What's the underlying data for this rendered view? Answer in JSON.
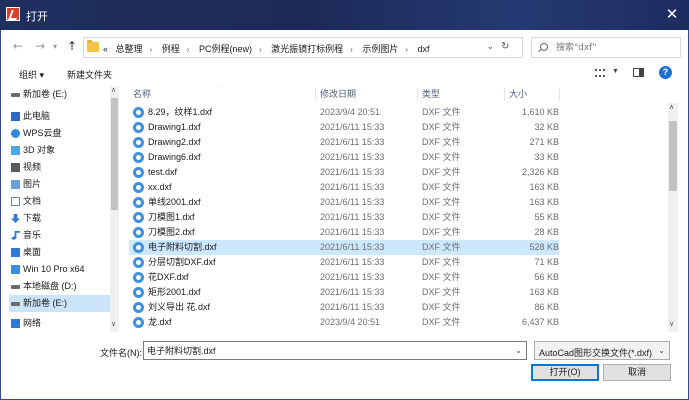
{
  "window": {
    "title": "打开",
    "close_label": "✕"
  },
  "address": {
    "crumbs": [
      "总整理",
      "例程",
      "PC例程(new)",
      "激光振镜打标例程",
      "示例图片",
      "dxf"
    ],
    "lead": "«"
  },
  "search": {
    "placeholder": "搜索\"dxf\""
  },
  "toolbar": {
    "organize_label": "组织 ▾",
    "newfolder_label": "新建文件夹",
    "help_label": "?"
  },
  "nav": {
    "items": [
      {
        "label": "新加卷 (E:)",
        "icon": "drive-icon"
      },
      {
        "label": "此电脑",
        "icon": "pc-icon"
      },
      {
        "label": "WPS云盘",
        "icon": "cloud-icon"
      },
      {
        "label": "3D 对象",
        "icon": "3d-icon"
      },
      {
        "label": "视频",
        "icon": "video-icon"
      },
      {
        "label": "图片",
        "icon": "picture-icon"
      },
      {
        "label": "文档",
        "icon": "document-icon"
      },
      {
        "label": "下载",
        "icon": "download-icon"
      },
      {
        "label": "音乐",
        "icon": "music-icon"
      },
      {
        "label": "桌面",
        "icon": "desktop-icon"
      },
      {
        "label": "Win 10 Pro x64",
        "icon": "windows-drive-icon"
      },
      {
        "label": "本地磁盘 (D:)",
        "icon": "drive-icon"
      },
      {
        "label": "新加卷 (E:)",
        "icon": "drive-icon",
        "selected": true
      },
      {
        "label": "网络",
        "icon": "network-icon"
      }
    ]
  },
  "columns": {
    "name": "名称",
    "date": "修改日期",
    "type": "类型",
    "size": "大小"
  },
  "files": [
    {
      "name": "8.29，纹样1.dxf",
      "date": "2023/9/4 20:51",
      "type": "DXF 文件",
      "size": "1,610 KB"
    },
    {
      "name": "Drawing1.dxf",
      "date": "2021/6/11 15:33",
      "type": "DXF 文件",
      "size": "32 KB"
    },
    {
      "name": "Drawing2.dxf",
      "date": "2021/6/11 15:33",
      "type": "DXF 文件",
      "size": "271 KB"
    },
    {
      "name": "Drawing6.dxf",
      "date": "2021/6/11 15:33",
      "type": "DXF 文件",
      "size": "33 KB"
    },
    {
      "name": "test.dxf",
      "date": "2021/6/11 15:33",
      "type": "DXF 文件",
      "size": "2,326 KB"
    },
    {
      "name": "xx.dxf",
      "date": "2021/6/11 15:33",
      "type": "DXF 文件",
      "size": "163 KB"
    },
    {
      "name": "单线2001.dxf",
      "date": "2021/6/11 15:33",
      "type": "DXF 文件",
      "size": "163 KB"
    },
    {
      "name": "刀模图1.dxf",
      "date": "2021/6/11 15:33",
      "type": "DXF 文件",
      "size": "55 KB"
    },
    {
      "name": "刀模图2.dxf",
      "date": "2021/6/11 15:33",
      "type": "DXF 文件",
      "size": "28 KB"
    },
    {
      "name": "电子附料切割.dxf",
      "date": "2021/6/11 15:33",
      "type": "DXF 文件",
      "size": "528 KB",
      "selected": true
    },
    {
      "name": "分层切割DXF.dxf",
      "date": "2021/6/11 15:33",
      "type": "DXF 文件",
      "size": "71 KB"
    },
    {
      "name": "花DXF.dxf",
      "date": "2021/6/11 15:33",
      "type": "DXF 文件",
      "size": "56 KB"
    },
    {
      "name": "矩形2001.dxf",
      "date": "2021/6/11 15:33",
      "type": "DXF 文件",
      "size": "163 KB"
    },
    {
      "name": "刘义导出 花.dxf",
      "date": "2021/6/11 15:33",
      "type": "DXF 文件",
      "size": "86 KB"
    },
    {
      "name": "龙.dxf",
      "date": "2023/9/4 20:51",
      "type": "DXF 文件",
      "size": "6,437 KB"
    }
  ],
  "filename": {
    "label": "文件名(N):",
    "value": "电子附料切割.dxf"
  },
  "filetype": {
    "value": "AutoCad图形交换文件(*.dxf)"
  },
  "buttons": {
    "open": "打开(O)",
    "cancel": "取消"
  },
  "colors": {
    "selection": "#cce8ff",
    "titlebar": "#1f2f5f",
    "accent": "#0078d7"
  }
}
